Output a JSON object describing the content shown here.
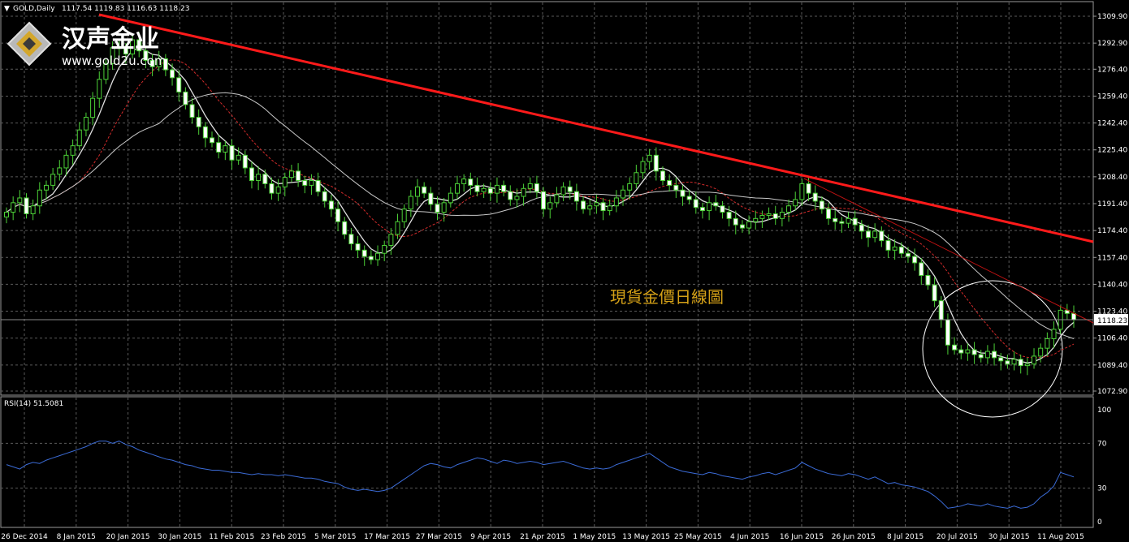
{
  "header": {
    "symbol": "GOLD,Daily",
    "ohlc": "1117.54 1119.83 1116.63 1118.23"
  },
  "logo": {
    "name": "汉声金业",
    "url": "www.gold2u.com"
  },
  "annotation": "現貨金價日線圖",
  "chart_data": [
    {
      "type": "candlestick",
      "title": "GOLD,Daily",
      "ylim": [
        1072.9,
        1309.9
      ],
      "y_ticks": [
        "1309.90",
        "1292.90",
        "1276.40",
        "1259.40",
        "1242.40",
        "1225.40",
        "1208.40",
        "1191.40",
        "1174.40",
        "1157.40",
        "1140.40",
        "1123.40",
        "1106.40",
        "1089.40",
        "1072.90"
      ],
      "current_price": "1118.23",
      "x_ticks": [
        "26 Dec 2014",
        "8 Jan 2015",
        "20 Jan 2015",
        "30 Jan 2015",
        "11 Feb 2015",
        "23 Feb 2015",
        "5 Mar 2015",
        "17 Mar 2015",
        "27 Mar 2015",
        "9 Apr 2015",
        "21 Apr 2015",
        "1 May 2015",
        "13 May 2015",
        "25 May 2015",
        "4 Jun 2015",
        "16 Jun 2015",
        "26 Jun 2015",
        "8 Jul 2015",
        "20 Jul 2015",
        "30 Jul 2015",
        "11 Aug 2015"
      ],
      "close_series": [
        1186,
        1192,
        1195,
        1185,
        1190,
        1200,
        1203,
        1210,
        1214,
        1222,
        1228,
        1238,
        1246,
        1258,
        1270,
        1280,
        1290,
        1290,
        1286,
        1295,
        1288,
        1282,
        1278,
        1283,
        1276,
        1271,
        1262,
        1254,
        1246,
        1240,
        1233,
        1230,
        1224,
        1228,
        1219,
        1222,
        1214,
        1206,
        1210,
        1204,
        1198,
        1202,
        1208,
        1212,
        1206,
        1203,
        1206,
        1199,
        1193,
        1188,
        1180,
        1172,
        1166,
        1162,
        1158,
        1156,
        1160,
        1165,
        1172,
        1180,
        1188,
        1196,
        1202,
        1198,
        1191,
        1186,
        1192,
        1198,
        1204,
        1207,
        1203,
        1199,
        1201,
        1198,
        1203,
        1199,
        1194,
        1196,
        1201,
        1204,
        1199,
        1188,
        1192,
        1197,
        1202,
        1199,
        1193,
        1188,
        1190,
        1192,
        1187,
        1190,
        1195,
        1200,
        1204,
        1211,
        1218,
        1222,
        1212,
        1206,
        1203,
        1200,
        1196,
        1194,
        1189,
        1187,
        1192,
        1190,
        1186,
        1182,
        1178,
        1176,
        1180,
        1182,
        1184,
        1185,
        1182,
        1186,
        1190,
        1194,
        1204,
        1198,
        1193,
        1188,
        1182,
        1180,
        1179,
        1182,
        1178,
        1174,
        1170,
        1174,
        1168,
        1162,
        1164,
        1160,
        1158,
        1154,
        1146,
        1140,
        1130,
        1118,
        1102,
        1099,
        1097,
        1099,
        1096,
        1094,
        1098,
        1094,
        1092,
        1090,
        1093,
        1089,
        1090,
        1095,
        1100,
        1106,
        1112,
        1124,
        1122,
        1118
      ]
    },
    {
      "type": "line",
      "title": "RSI(14) 51.5081",
      "ylim": [
        0,
        100
      ],
      "y_ticks": [
        "100",
        "70",
        "30",
        "0"
      ],
      "values": [
        51,
        49,
        47,
        51,
        53,
        52,
        55,
        57,
        59,
        61,
        63,
        65,
        67,
        70,
        72,
        72,
        70,
        72,
        69,
        67,
        64,
        62,
        60,
        58,
        56,
        55,
        53,
        51,
        50,
        48,
        47,
        46,
        46,
        45,
        44,
        44,
        43,
        42,
        43,
        42,
        42,
        41,
        42,
        41,
        40,
        39,
        39,
        38,
        36,
        35,
        34,
        31,
        29,
        28,
        29,
        28,
        27,
        28,
        30,
        34,
        38,
        42,
        46,
        50,
        52,
        51,
        49,
        48,
        51,
        53,
        55,
        57,
        56,
        54,
        52,
        55,
        54,
        52,
        53,
        54,
        53,
        51,
        52,
        53,
        54,
        52,
        50,
        48,
        47,
        48,
        47,
        48,
        51,
        53,
        55,
        57,
        59,
        61,
        57,
        53,
        49,
        47,
        45,
        44,
        43,
        42,
        44,
        43,
        41,
        40,
        39,
        38,
        40,
        41,
        43,
        44,
        42,
        44,
        46,
        48,
        53,
        50,
        47,
        45,
        43,
        42,
        41,
        43,
        42,
        40,
        38,
        40,
        37,
        34,
        35,
        33,
        32,
        31,
        29,
        27,
        23,
        18,
        12,
        13,
        14,
        16,
        15,
        14,
        16,
        14,
        13,
        12,
        14,
        12,
        13,
        16,
        22,
        26,
        32,
        44,
        42,
        40
      ]
    }
  ]
}
